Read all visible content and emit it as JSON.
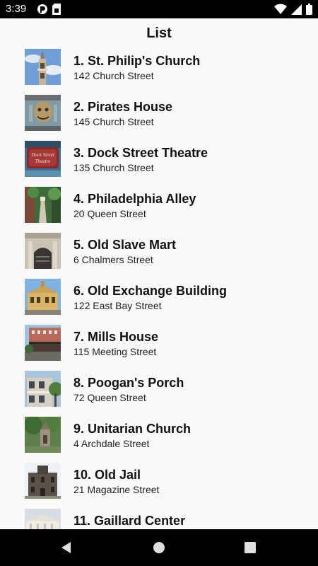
{
  "status_bar": {
    "time": "3:39",
    "icons": [
      "app-notification-icon",
      "sim-card-icon",
      "wifi-icon",
      "cellular-signal-icon",
      "battery-icon"
    ]
  },
  "header": {
    "title": "List"
  },
  "items": [
    {
      "title": "1. St. Philip's Church",
      "address": "142 Church Street"
    },
    {
      "title": "2. Pirates House",
      "address": "145 Church Street"
    },
    {
      "title": "3. Dock Street Theatre",
      "address": "135 Church Street"
    },
    {
      "title": "4. Philadelphia Alley",
      "address": "20 Queen Street"
    },
    {
      "title": "5. Old Slave Mart",
      "address": "6 Chalmers Street"
    },
    {
      "title": "6. Old Exchange Building",
      "address": "122 East Bay Street"
    },
    {
      "title": "7. Mills House",
      "address": "115 Meeting Street"
    },
    {
      "title": "8. Poogan's Porch",
      "address": "72 Queen Street"
    },
    {
      "title": "9. Unitarian Church",
      "address": "4 Archdale Street"
    },
    {
      "title": "10. Old Jail",
      "address": "21 Magazine Street"
    },
    {
      "title": "11. Gaillard Center",
      "address": ""
    }
  ],
  "thumbnail_sign_text": [
    "Dock Street",
    "Theatre"
  ],
  "nav_bar": {
    "buttons": [
      "back-icon",
      "home-icon",
      "recents-icon"
    ]
  },
  "colors": {
    "background": "#fafafa",
    "status_bar": "#000000",
    "nav_bar": "#000000",
    "text": "#111111"
  }
}
